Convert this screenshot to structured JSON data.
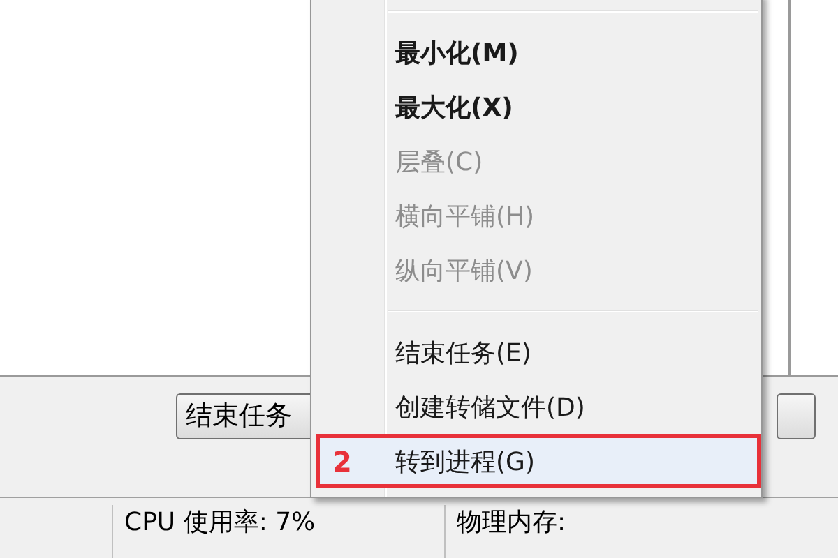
{
  "buttons": [
    {
      "label": "结束任务"
    }
  ],
  "menu": {
    "items": [
      {
        "kind": "separator"
      },
      {
        "kind": "item",
        "label": "最小化(M)",
        "bold": true,
        "disabled": false,
        "selected": false
      },
      {
        "kind": "item",
        "label": "最大化(X)",
        "bold": true,
        "disabled": false,
        "selected": false
      },
      {
        "kind": "item",
        "label": "层叠(C)",
        "bold": false,
        "disabled": true,
        "selected": false
      },
      {
        "kind": "item",
        "label": "横向平铺(H)",
        "bold": false,
        "disabled": true,
        "selected": false
      },
      {
        "kind": "item",
        "label": "纵向平铺(V)",
        "bold": false,
        "disabled": true,
        "selected": false
      },
      {
        "kind": "separator"
      },
      {
        "kind": "item",
        "label": "结束任务(E)",
        "bold": false,
        "disabled": false,
        "selected": false
      },
      {
        "kind": "item",
        "label": "创建转储文件(D)",
        "bold": false,
        "disabled": false,
        "selected": false
      },
      {
        "kind": "item",
        "label": "转到进程(G)",
        "bold": false,
        "disabled": false,
        "selected": true,
        "annotation": "2"
      }
    ]
  },
  "status_bar": [
    {
      "text": "CPU 使用率: 7%"
    },
    {
      "text": "物理内存:"
    }
  ]
}
